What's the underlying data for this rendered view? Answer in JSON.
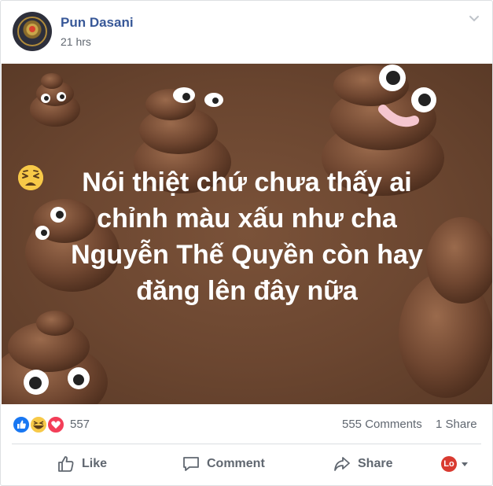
{
  "post": {
    "author": "Pun Dasani",
    "timestamp": "21 hrs",
    "text_lines": [
      "Nói thiệt chứ chưa thấy ai",
      "chỉnh màu xấu như cha",
      "Nguyễn Thế Quyền",
      "còn hay",
      "đăng lên đây nữa"
    ],
    "background_theme": "poop-emoji",
    "colors": {
      "author": "#385898",
      "banner": "#6b4630",
      "text": "#ffffff"
    }
  },
  "stats": {
    "reaction_icons": [
      "like-icon",
      "haha-icon",
      "love-icon"
    ],
    "reaction_count": "557",
    "comments": "555 Comments",
    "shares": "1 Share"
  },
  "actions": {
    "like": "Like",
    "comment": "Comment",
    "share": "Share",
    "react_avatar": "Lo"
  }
}
